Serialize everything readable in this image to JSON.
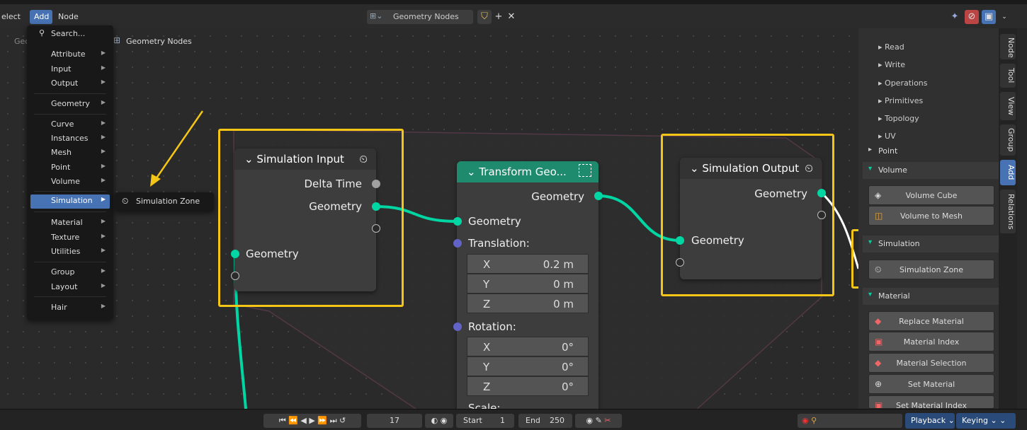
{
  "topbar": {
    "menu_select": "elect",
    "menu_add": "Add",
    "menu_node": "Node",
    "tree_name": "Geometry Nodes"
  },
  "breadcrumb": {
    "modifier": "GeometryNodes",
    "tree": "Geometry Nodes"
  },
  "add_menu": {
    "search": "Search...",
    "items": [
      "Attribute",
      "Input",
      "Output",
      "Geometry",
      "Curve",
      "Instances",
      "Mesh",
      "Point",
      "Volume",
      "Simulation",
      "Material",
      "Texture",
      "Utilities",
      "Group",
      "Layout",
      "Hair"
    ],
    "highlighted": "Simulation"
  },
  "submenu": {
    "item": "Simulation Zone"
  },
  "nodes": {
    "sim_input": {
      "title": "Simulation Input",
      "out_delta": "Delta Time",
      "out_geo": "Geometry",
      "in_geo": "Geometry"
    },
    "transform": {
      "title": "Transform Geo...",
      "out_geo": "Geometry",
      "in_geo": "Geometry",
      "translation_label": "Translation:",
      "translation": [
        {
          "axis": "X",
          "value": "0.2 m"
        },
        {
          "axis": "Y",
          "value": "0 m"
        },
        {
          "axis": "Z",
          "value": "0 m"
        }
      ],
      "rotation_label": "Rotation:",
      "rotation": [
        {
          "axis": "X",
          "value": "0°"
        },
        {
          "axis": "Y",
          "value": "0°"
        },
        {
          "axis": "Z",
          "value": "0°"
        }
      ],
      "scale_label": "Scale:"
    },
    "sim_output": {
      "title": "Simulation Output",
      "out_geo": "Geometry",
      "in_geo": "Geometry"
    }
  },
  "sidebar": {
    "mesh_items": [
      "Read",
      "Write",
      "Operations",
      "Primitives",
      "Topology",
      "UV"
    ],
    "point_panel": "Point",
    "volume_panel": "Volume",
    "volume_buttons": [
      "Volume Cube",
      "Volume to Mesh"
    ],
    "simulation_panel": "Simulation",
    "simulation_buttons": [
      "Simulation Zone"
    ],
    "material_panel": "Material",
    "material_buttons": [
      "Replace Material",
      "Material Index",
      "Material Selection",
      "Set Material",
      "Set Material Index"
    ],
    "tabs": [
      "Node",
      "Tool",
      "View",
      "Group",
      "Add",
      "Relations"
    ],
    "active_tab": "Add"
  },
  "timeline": {
    "current_frame": "17",
    "start_label": "Start",
    "start": "1",
    "end_label": "End",
    "end": "250",
    "playback": "Playback",
    "keying": "Keying"
  },
  "colors": {
    "highlight": "#f5c518",
    "geometry_socket": "#00d6a3",
    "accent_blue": "#4772b3",
    "transform_header": "#1e8a6e",
    "sim_header": "#3d3d3d"
  }
}
